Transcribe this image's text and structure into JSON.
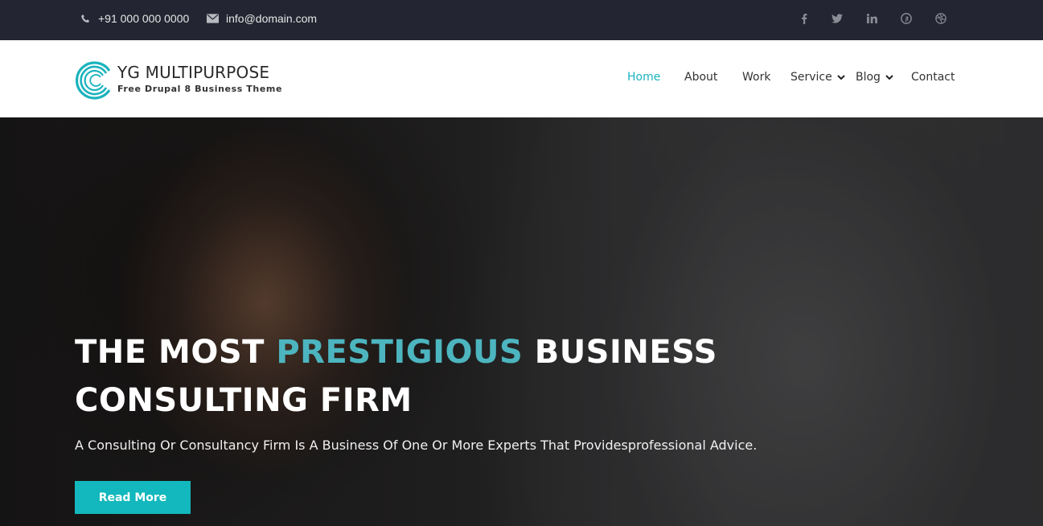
{
  "topbar": {
    "phone": "+91 000 000 0000",
    "email": "info@domain.com",
    "social": [
      "facebook-icon",
      "twitter-icon",
      "linkedin-icon",
      "pinterest-icon",
      "dribbble-icon"
    ]
  },
  "header": {
    "brand": "YG MULTIPURPOSE",
    "tagline": "Free Drupal 8 Business Theme",
    "nav": [
      {
        "label": "Home",
        "active": true
      },
      {
        "label": "About"
      },
      {
        "label": "Work"
      },
      {
        "label": "Service",
        "dropdown": true
      },
      {
        "label": "Blog",
        "dropdown": true
      },
      {
        "label": "Contact"
      }
    ]
  },
  "hero": {
    "title_part1": "THE MOST ",
    "title_accent": "PRESTIGIOUS",
    "title_part2": " BUSINESS CONSULTING FIRM",
    "subtitle": "A Consulting Or Consultancy Firm Is A Business Of One Or More Experts That Providesprofessional Advice.",
    "button_label": "Read More"
  },
  "colors": {
    "accent": "#1ab3bd",
    "topbar_bg": "#232632",
    "button_bg": "#12b8bd"
  }
}
